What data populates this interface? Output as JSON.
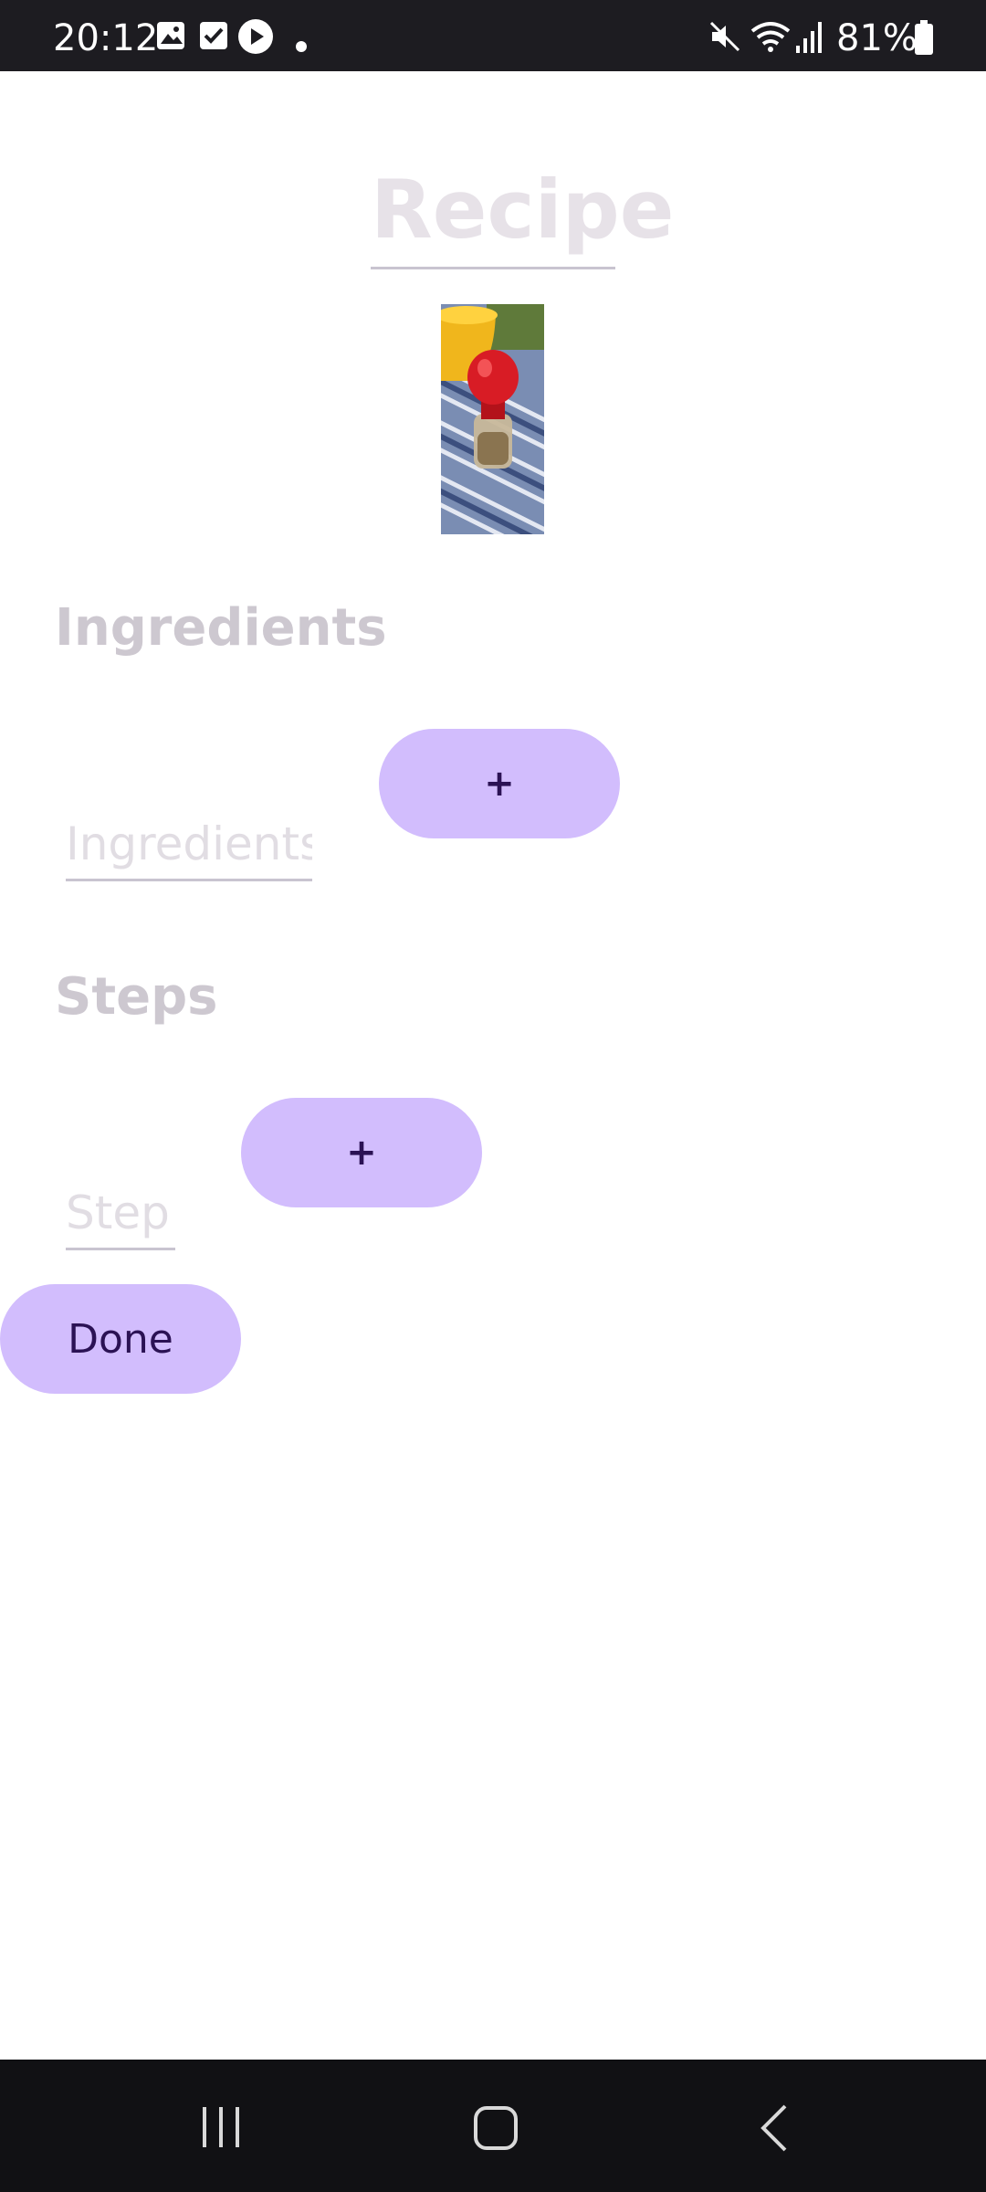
{
  "status_bar": {
    "time": "20:12",
    "battery": "81%",
    "icons": [
      "gallery-icon",
      "checkbox-icon",
      "play-icon",
      "dot-icon",
      "mute-icon",
      "wifi-icon",
      "signal-icon",
      "battery-icon"
    ]
  },
  "recipe": {
    "title": "Recipe",
    "photo_alt": "pepper-grinder-photo"
  },
  "ingredients": {
    "heading": "Ingredients",
    "input_placeholder": "Ingredients",
    "add_label": "+"
  },
  "steps": {
    "heading": "Steps",
    "input_placeholder": "Step",
    "add_label": "+"
  },
  "actions": {
    "done_label": "Done"
  },
  "colors": {
    "button_bg": "#d2bdfd",
    "button_text": "#2b1254",
    "heading_text": "#cdc8d0",
    "title_text": "#e7e2e8"
  }
}
